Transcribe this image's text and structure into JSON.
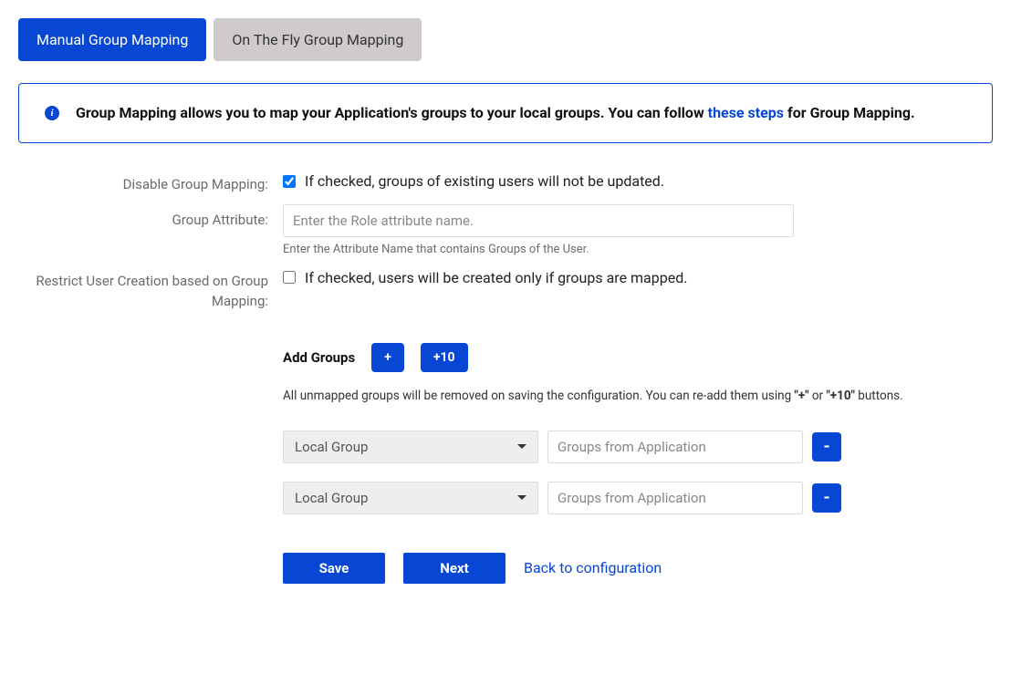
{
  "tabs": {
    "manual": "Manual Group Mapping",
    "onthefly": "On The Fly Group Mapping"
  },
  "info": {
    "text_before": "Group Mapping allows you to map your Application's groups to your local groups. You can follow ",
    "link_text": "these steps",
    "text_after": " for Group Mapping."
  },
  "form": {
    "disable_label": "Disable Group Mapping:",
    "disable_checkbox_label": "If checked, groups of existing users will not be updated.",
    "disable_checked": true,
    "group_attr_label": "Group Attribute:",
    "group_attr_placeholder": "Enter the Role attribute name.",
    "group_attr_help": "Enter the Attribute Name that contains Groups of the User.",
    "restrict_label": "Restrict User Creation based on Group Mapping:",
    "restrict_checkbox_label": "If checked, users will be created only if groups are mapped.",
    "restrict_checked": false
  },
  "add_groups": {
    "heading": "Add Groups",
    "plus_label": "+",
    "plus10_label": "+10",
    "instruction_before": "All unmapped groups will be removed on saving the configuration. You can re-add them using ",
    "instruction_q1": "\"+\"",
    "instruction_mid": " or ",
    "instruction_q2": "\"+10\"",
    "instruction_after": " buttons."
  },
  "group_rows": [
    {
      "local_label": "Local Group",
      "app_placeholder": "Groups from Application",
      "remove_label": "-"
    },
    {
      "local_label": "Local Group",
      "app_placeholder": "Groups from Application",
      "remove_label": "-"
    }
  ],
  "actions": {
    "save": "Save",
    "next": "Next",
    "back": "Back to configuration"
  }
}
